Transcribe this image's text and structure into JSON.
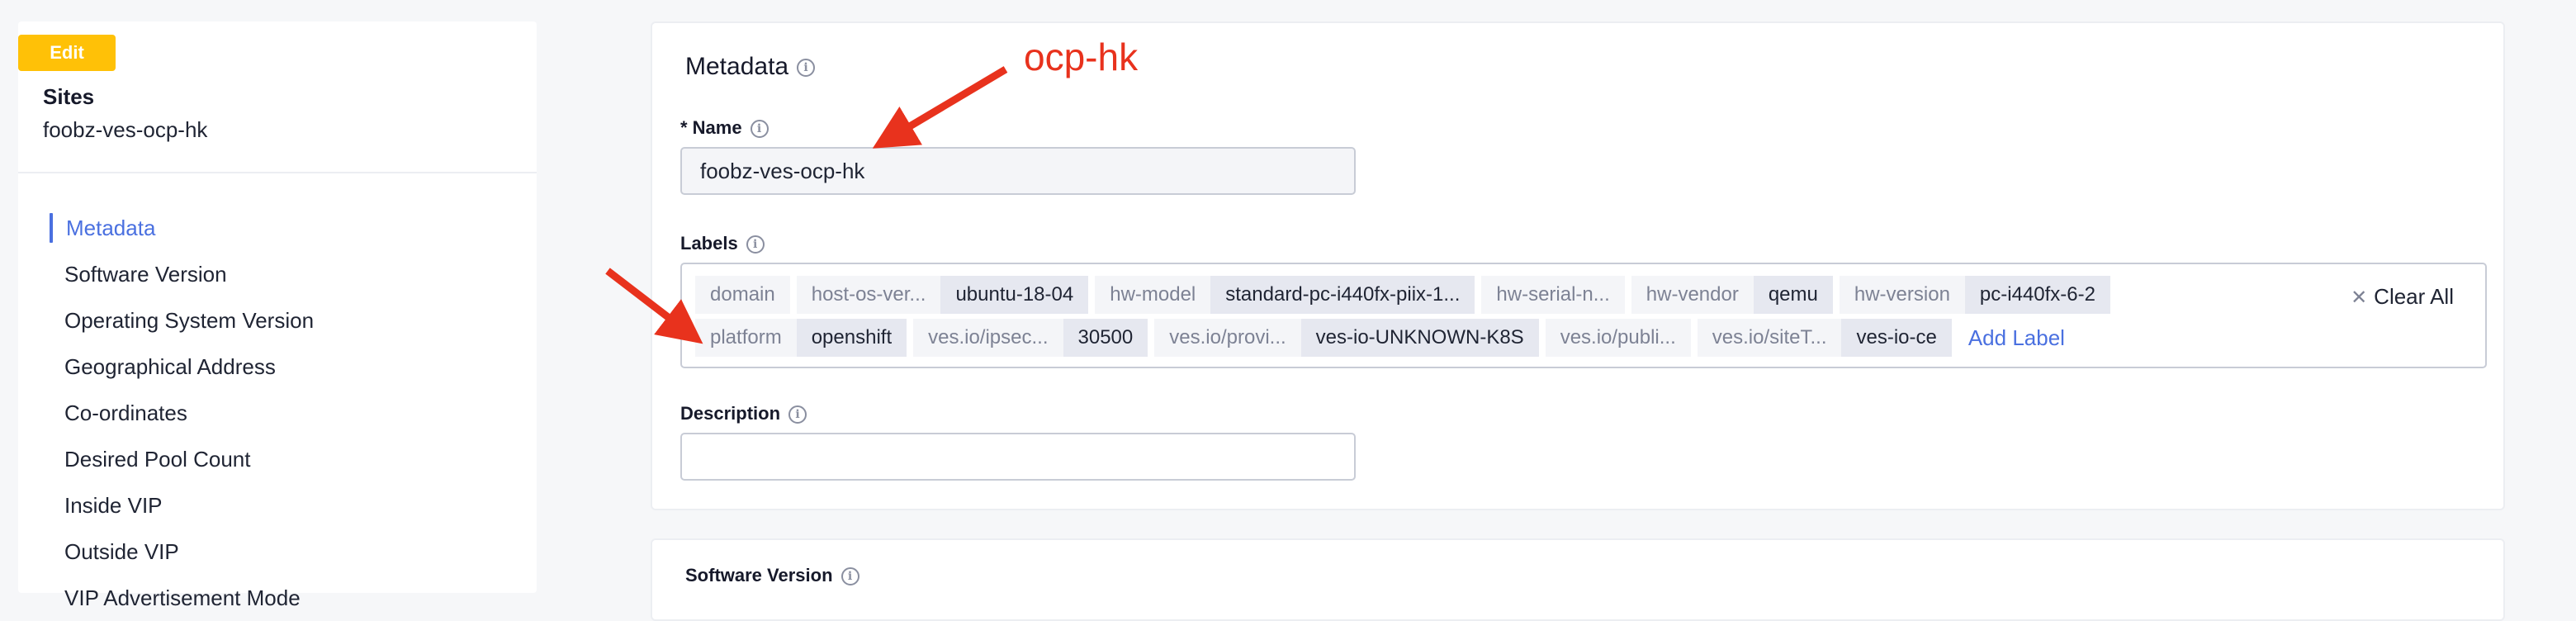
{
  "sidebar": {
    "badge": "Edit",
    "title": "Sites",
    "subtitle": "foobz-ves-ocp-hk",
    "items": [
      {
        "label": "Metadata"
      },
      {
        "label": "Software Version"
      },
      {
        "label": "Operating System Version"
      },
      {
        "label": "Geographical Address"
      },
      {
        "label": "Co-ordinates"
      },
      {
        "label": "Desired Pool Count"
      },
      {
        "label": "Inside VIP"
      },
      {
        "label": "Outside VIP"
      },
      {
        "label": "VIP Advertisement Mode"
      }
    ]
  },
  "main": {
    "section_title": "Metadata",
    "name_label": "* Name",
    "name_value": "foobz-ves-ocp-hk",
    "labels_label": "Labels",
    "labels_row1": [
      {
        "key": "domain",
        "value": ""
      },
      {
        "key": "host-os-ver...",
        "value": "ubuntu-18-04"
      },
      {
        "key": "hw-model",
        "value": "standard-pc-i440fx-piix-1..."
      },
      {
        "key": "hw-serial-n...",
        "value": ""
      },
      {
        "key": "hw-vendor",
        "value": "qemu"
      },
      {
        "key": "hw-version",
        "value": "pc-i440fx-6-2"
      }
    ],
    "labels_row2": [
      {
        "key": "platform",
        "value": "openshift"
      },
      {
        "key": "ves.io/ipsec...",
        "value": "30500"
      },
      {
        "key": "ves.io/provi...",
        "value": "ves-io-UNKNOWN-K8S"
      },
      {
        "key": "ves.io/publi...",
        "value": ""
      },
      {
        "key": "ves.io/siteT...",
        "value": "ves-io-ce"
      }
    ],
    "add_label": "Add Label",
    "clear_all": "Clear All",
    "description_label": "Description",
    "description_value": "",
    "next_section_title": "Software Version"
  },
  "annotation": {
    "text": "ocp-hk",
    "color": "#e8321d"
  },
  "colors": {
    "accent": "#4a70e0",
    "badge": "#ffc107"
  }
}
